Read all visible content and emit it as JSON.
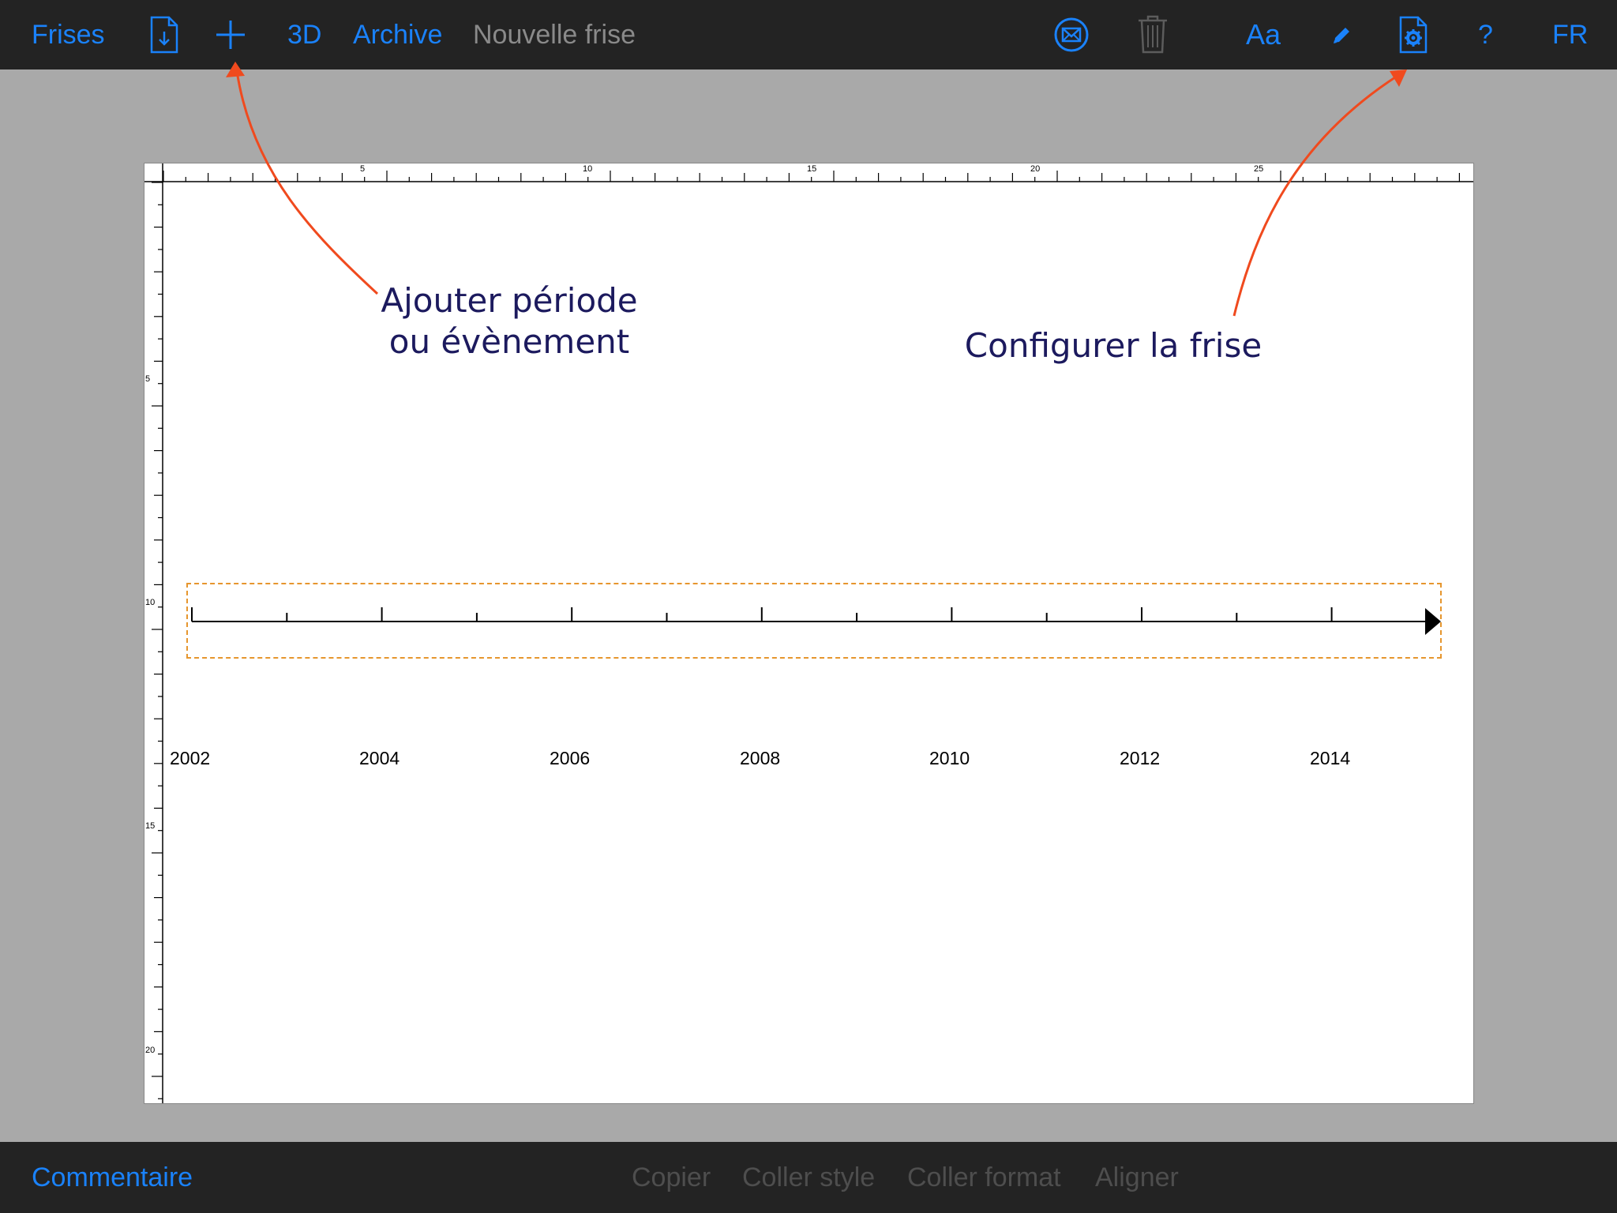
{
  "toolbar": {
    "frises": "Frises",
    "three_d": "3D",
    "archive": "Archive",
    "title": "Nouvelle frise",
    "font_button": "Aa",
    "help": "?",
    "language": "FR",
    "icons": [
      "download-icon",
      "plus-icon",
      "mail-icon",
      "trash-icon",
      "pencil-icon",
      "settings-document-icon"
    ]
  },
  "annotations": {
    "add_line1": "Ajouter période",
    "add_line2": "ou évènement",
    "configure": "Configurer la frise"
  },
  "ruler": {
    "top_labels": [
      "5",
      "10",
      "15",
      "20",
      "25"
    ],
    "left_labels": [
      "5",
      "10",
      "15",
      "20"
    ]
  },
  "timeline": {
    "years": [
      "2002",
      "2004",
      "2006",
      "2008",
      "2010",
      "2012",
      "2014"
    ]
  },
  "bottombar": {
    "comment": "Commentaire",
    "copy": "Copier",
    "paste_style": "Coller style",
    "paste_format": "Coller format",
    "align": "Aligner"
  },
  "colors": {
    "accent": "#1a82fb",
    "bar_bg": "#232323",
    "canvas_bg": "#a9a9a9",
    "annotation_text": "#1c1a5e",
    "arrow": "#f04a1e",
    "selection": "#e6962e"
  }
}
